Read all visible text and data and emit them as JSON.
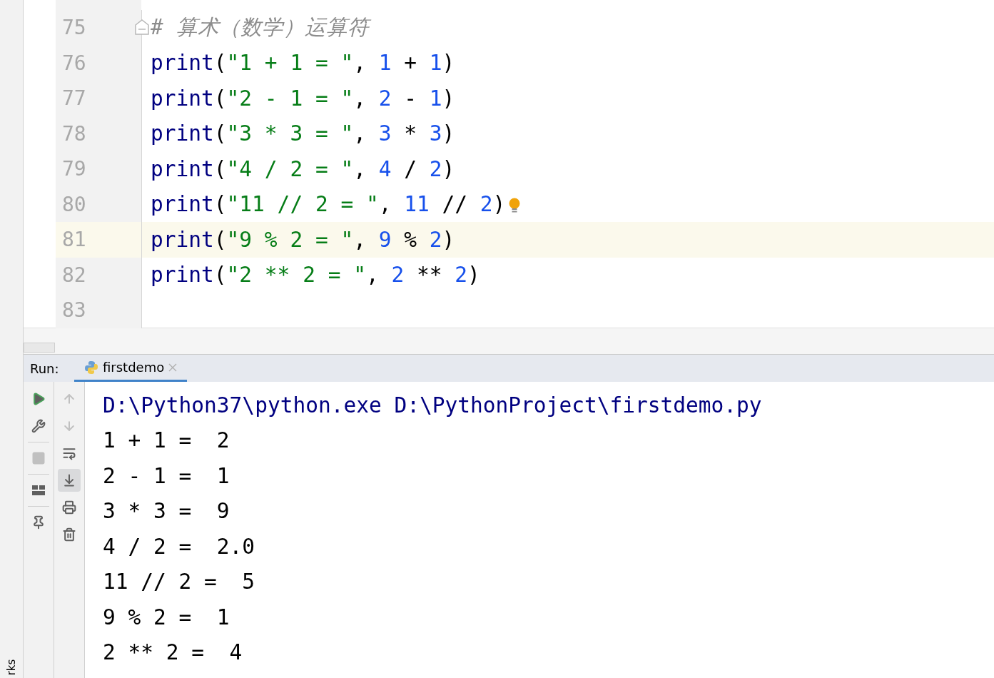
{
  "side_strip": {
    "label": "rks"
  },
  "editor": {
    "lines": [
      {
        "number": "75",
        "current": false,
        "folded_start": true,
        "tokens": [
          {
            "text": "# 算术（数学）运算符",
            "kind": "comment"
          }
        ]
      },
      {
        "number": "76",
        "current": false,
        "tokens": [
          {
            "text": "print",
            "kind": "builtin"
          },
          {
            "text": "(",
            "kind": "punct"
          },
          {
            "text": "\"1 + 1 = \"",
            "kind": "string"
          },
          {
            "text": ", ",
            "kind": "punct"
          },
          {
            "text": "1",
            "kind": "number"
          },
          {
            "text": " + ",
            "kind": "punct"
          },
          {
            "text": "1",
            "kind": "number"
          },
          {
            "text": ")",
            "kind": "punct"
          }
        ]
      },
      {
        "number": "77",
        "current": false,
        "tokens": [
          {
            "text": "print",
            "kind": "builtin"
          },
          {
            "text": "(",
            "kind": "punct"
          },
          {
            "text": "\"2 - 1 = \"",
            "kind": "string"
          },
          {
            "text": ", ",
            "kind": "punct"
          },
          {
            "text": "2",
            "kind": "number"
          },
          {
            "text": " - ",
            "kind": "punct"
          },
          {
            "text": "1",
            "kind": "number"
          },
          {
            "text": ")",
            "kind": "punct"
          }
        ]
      },
      {
        "number": "78",
        "current": false,
        "tokens": [
          {
            "text": "print",
            "kind": "builtin"
          },
          {
            "text": "(",
            "kind": "punct"
          },
          {
            "text": "\"3 * 3 = \"",
            "kind": "string"
          },
          {
            "text": ", ",
            "kind": "punct"
          },
          {
            "text": "3",
            "kind": "number"
          },
          {
            "text": " * ",
            "kind": "punct"
          },
          {
            "text": "3",
            "kind": "number"
          },
          {
            "text": ")",
            "kind": "punct"
          }
        ]
      },
      {
        "number": "79",
        "current": false,
        "tokens": [
          {
            "text": "print",
            "kind": "builtin"
          },
          {
            "text": "(",
            "kind": "punct"
          },
          {
            "text": "\"4 / 2 = \"",
            "kind": "string"
          },
          {
            "text": ", ",
            "kind": "punct"
          },
          {
            "text": "4",
            "kind": "number"
          },
          {
            "text": " / ",
            "kind": "punct"
          },
          {
            "text": "2",
            "kind": "number"
          },
          {
            "text": ")",
            "kind": "punct"
          }
        ]
      },
      {
        "number": "80",
        "current": false,
        "hint": true,
        "tokens": [
          {
            "text": "print",
            "kind": "builtin"
          },
          {
            "text": "(",
            "kind": "punct"
          },
          {
            "text": "\"11 // 2 = \"",
            "kind": "string"
          },
          {
            "text": ", ",
            "kind": "punct"
          },
          {
            "text": "11",
            "kind": "number"
          },
          {
            "text": " // ",
            "kind": "punct"
          },
          {
            "text": "2",
            "kind": "number"
          },
          {
            "text": ")",
            "kind": "punct"
          }
        ]
      },
      {
        "number": "81",
        "current": true,
        "tokens": [
          {
            "text": "print",
            "kind": "builtin"
          },
          {
            "text": "(",
            "kind": "punct"
          },
          {
            "text": "\"9 % 2 = \"",
            "kind": "string"
          },
          {
            "text": ", ",
            "kind": "punct"
          },
          {
            "text": "9",
            "kind": "number"
          },
          {
            "text": " % ",
            "kind": "punct"
          },
          {
            "text": "2",
            "kind": "number"
          },
          {
            "text": ")",
            "kind": "punct"
          }
        ]
      },
      {
        "number": "82",
        "current": false,
        "tokens": [
          {
            "text": "print",
            "kind": "builtin"
          },
          {
            "text": "(",
            "kind": "punct"
          },
          {
            "text": "\"2 ** 2 = \"",
            "kind": "string"
          },
          {
            "text": ", ",
            "kind": "punct"
          },
          {
            "text": "2",
            "kind": "number"
          },
          {
            "text": " ** ",
            "kind": "punct"
          },
          {
            "text": "2",
            "kind": "number"
          },
          {
            "text": ")",
            "kind": "punct"
          }
        ]
      },
      {
        "number": "83",
        "current": false
      }
    ]
  },
  "run_panel": {
    "label": "Run:",
    "tabs": [
      {
        "label": "firstdemo",
        "selected": true
      }
    ],
    "toolbar_left": [
      {
        "kind": "run",
        "disabled": false
      },
      {
        "kind": "wrench",
        "disabled": false
      },
      {
        "kind": "stop",
        "disabled": true
      },
      {
        "kind": "layout",
        "disabled": false
      },
      {
        "kind": "pin",
        "disabled": false
      }
    ],
    "toolbar_right": [
      {
        "kind": "up",
        "disabled": true,
        "on": false
      },
      {
        "kind": "down",
        "disabled": true,
        "on": false
      },
      {
        "kind": "wrap",
        "disabled": false,
        "on": false
      },
      {
        "kind": "scroll_end",
        "disabled": false,
        "on": true
      },
      {
        "kind": "print",
        "disabled": false,
        "on": false
      },
      {
        "kind": "trash",
        "disabled": false,
        "on": false
      }
    ],
    "console": [
      {
        "text": "D:\\Python37\\python.exe D:\\PythonProject\\firstdemo.py",
        "kind": "command"
      },
      {
        "text": "1 + 1 =  2",
        "kind": "output"
      },
      {
        "text": "2 - 1 =  1",
        "kind": "output"
      },
      {
        "text": "3 * 3 =  9",
        "kind": "output"
      },
      {
        "text": "4 / 2 =  2.0",
        "kind": "output"
      },
      {
        "text": "11 // 2 =  5",
        "kind": "output"
      },
      {
        "text": "9 % 2 =  1",
        "kind": "output"
      },
      {
        "text": "2 ** 2 =  4",
        "kind": "output"
      }
    ]
  }
}
